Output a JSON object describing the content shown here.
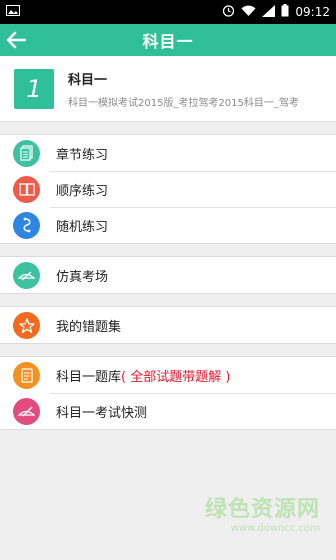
{
  "status": {
    "time": "09:12"
  },
  "appbar": {
    "title": "科目一"
  },
  "subject": {
    "number": "1",
    "name": "科目一",
    "description": "科目一模拟考试2015版_考拉驾考2015科目一_驾考"
  },
  "groups": [
    [
      {
        "label": "章节练习",
        "color": "#3ec1a1",
        "icon": "document-icon"
      },
      {
        "label": "顺序练习",
        "color": "#f05a4a",
        "icon": "book-icon"
      },
      {
        "label": "随机练习",
        "color": "#2f86e0",
        "icon": "shuffle-icon"
      }
    ],
    [
      {
        "label": "仿真考场",
        "color": "#3ec1a1",
        "icon": "exam-pen-icon"
      }
    ],
    [
      {
        "label": "我的错题集",
        "color": "#f26a1f",
        "icon": "star-icon"
      }
    ],
    [
      {
        "label": "科目一题库",
        "extra": "( 全部试题带题解 )",
        "color": "#f39222",
        "icon": "question-bank-icon"
      },
      {
        "label": "科目一考试快测",
        "color": "#e24c7f",
        "icon": "quick-test-icon"
      }
    ]
  ],
  "watermark": {
    "cn": "绿色资源网",
    "en": "www.downcc.com"
  }
}
